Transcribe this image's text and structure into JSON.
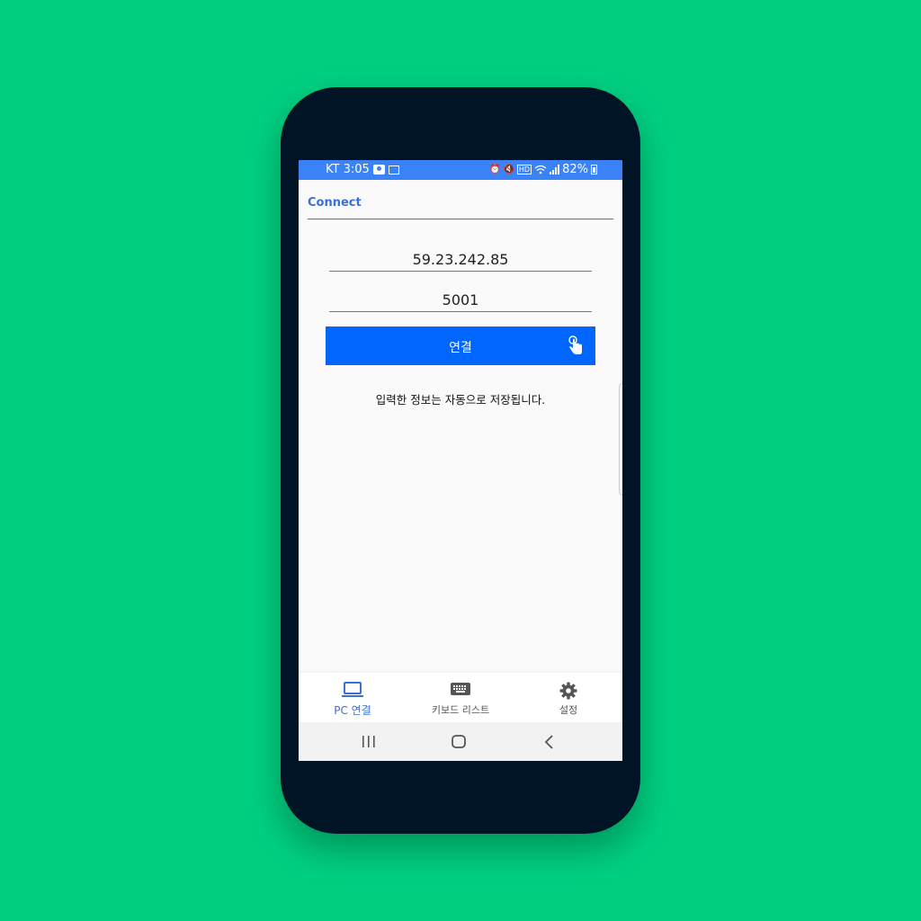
{
  "status_bar": {
    "carrier_time": "KT 3:05",
    "battery": "82%",
    "icons": [
      "photo-icon",
      "gallery-icon",
      "alarm-icon",
      "mute-icon",
      "hd-icon",
      "wifi-icon",
      "signal-icon",
      "battery-icon"
    ]
  },
  "header": {
    "title": "Connect"
  },
  "form": {
    "ip_value": "59.23.242.85",
    "port_value": "5001",
    "connect_label": "연결",
    "info_text": "입력한 정보는 자동으로 저장됩니다."
  },
  "bottom_nav": {
    "items": [
      {
        "label": "PC 연결",
        "icon": "laptop-icon",
        "active": true
      },
      {
        "label": "키보드 리스트",
        "icon": "keyboard-icon",
        "active": false
      },
      {
        "label": "설정",
        "icon": "gear-icon",
        "active": false
      }
    ]
  },
  "colors": {
    "background": "#00CF80",
    "phone_frame": "#001425",
    "status_bar": "#3B82F6",
    "accent": "#3B6FD9",
    "button": "#0066FF"
  }
}
